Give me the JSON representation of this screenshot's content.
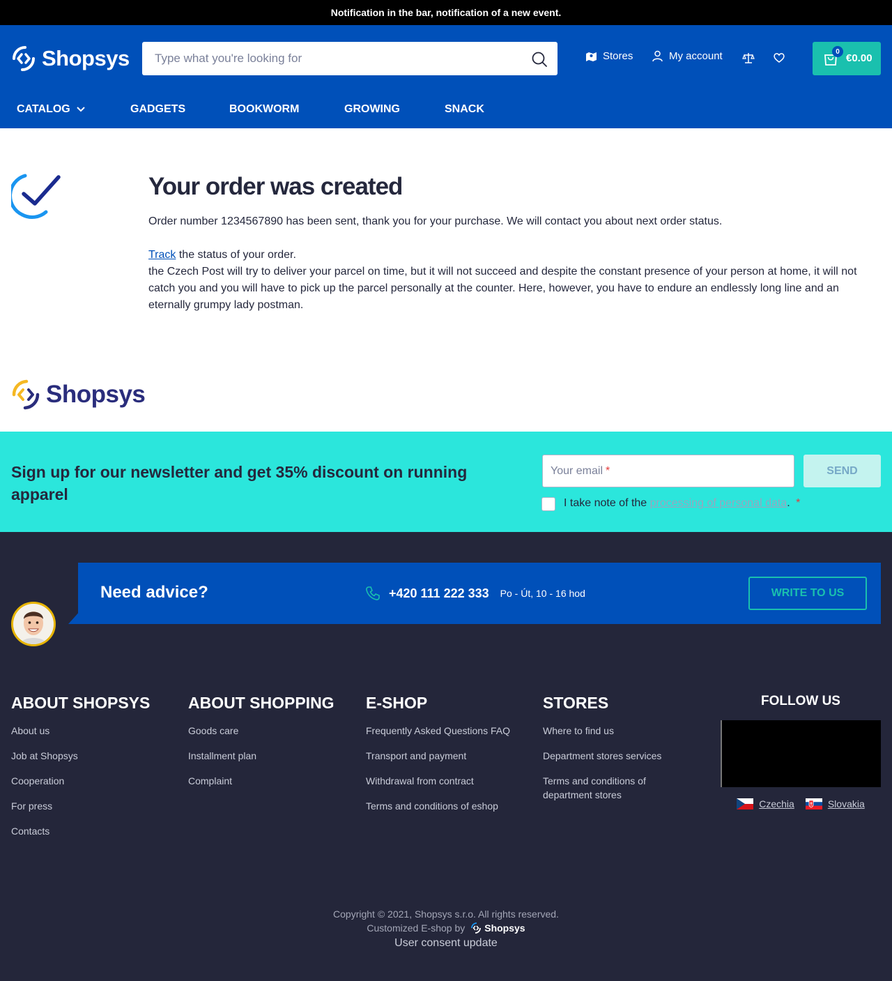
{
  "notification": "Notification in the bar, notification of a new event.",
  "header": {
    "logo_text": "Shopsys",
    "search_placeholder": "Type what you're looking for",
    "stores_label": "Stores",
    "account_label": "My account",
    "cart_count": "0",
    "cart_price": "€0.00"
  },
  "nav": {
    "items": [
      "CATALOG",
      "GADGETS",
      "BOOKWORM",
      "GROWING",
      "SNACK"
    ]
  },
  "order": {
    "title": "Your order was created",
    "line1": "Order number 1234567890 has been sent, thank you for your purchase. We will contact you about next order status.",
    "track_link": "Track",
    "track_rest": " the status of your order.",
    "line3": "the Czech Post will try to deliver your parcel on time, but it will not succeed and despite the constant presence of your person at home, it will not catch you and you will have to pick up the parcel personally at the counter. Here, however, you have to endure an endlessly long line and an eternally grumpy lady postman."
  },
  "footer_logo_text": "Shopsys",
  "newsletter": {
    "title": "Sign up for our newsletter and get 35% discount on running apparel",
    "email_placeholder": "Your email",
    "required_mark": "*",
    "send_label": "SEND",
    "consent_prefix": "I take note of the ",
    "consent_link": "processing of personal data",
    "consent_suffix": "."
  },
  "advice": {
    "title": "Need advice?",
    "phone": "+420 111 222 333",
    "hours": "Po - Út, 10 - 16 hod",
    "write_label": "WRITE TO US"
  },
  "columns": [
    {
      "title": "ABOUT SHOPSYS",
      "items": [
        "About us",
        "Job at Shopsys",
        "Cooperation",
        "For press",
        "Contacts"
      ]
    },
    {
      "title": "ABOUT SHOPPING",
      "items": [
        "Goods care",
        "Installment plan",
        "Complaint"
      ]
    },
    {
      "title": "E-SHOP",
      "items": [
        "Frequently Asked Questions FAQ",
        "Transport and payment",
        "Withdrawal from contract",
        "Terms and conditions of eshop"
      ]
    },
    {
      "title": "STORES",
      "items": [
        "Where to find us",
        "Department stores services",
        "Terms and conditions of department stores"
      ]
    }
  ],
  "follow": {
    "title": "FOLLOW US",
    "countries": [
      "Czechia",
      "Slovakia"
    ]
  },
  "bottom": {
    "copyright": "Copyright © 2021, Shopsys s.r.o. All rights reserved.",
    "customized": "Customized E-shop by",
    "brand": "Shopsys",
    "consent": "User consent update"
  },
  "colors": {
    "primary": "#0050b9",
    "accent": "#1ac0ae",
    "newsletter_bg": "#2be6dc",
    "footer_bg": "#24263a"
  }
}
